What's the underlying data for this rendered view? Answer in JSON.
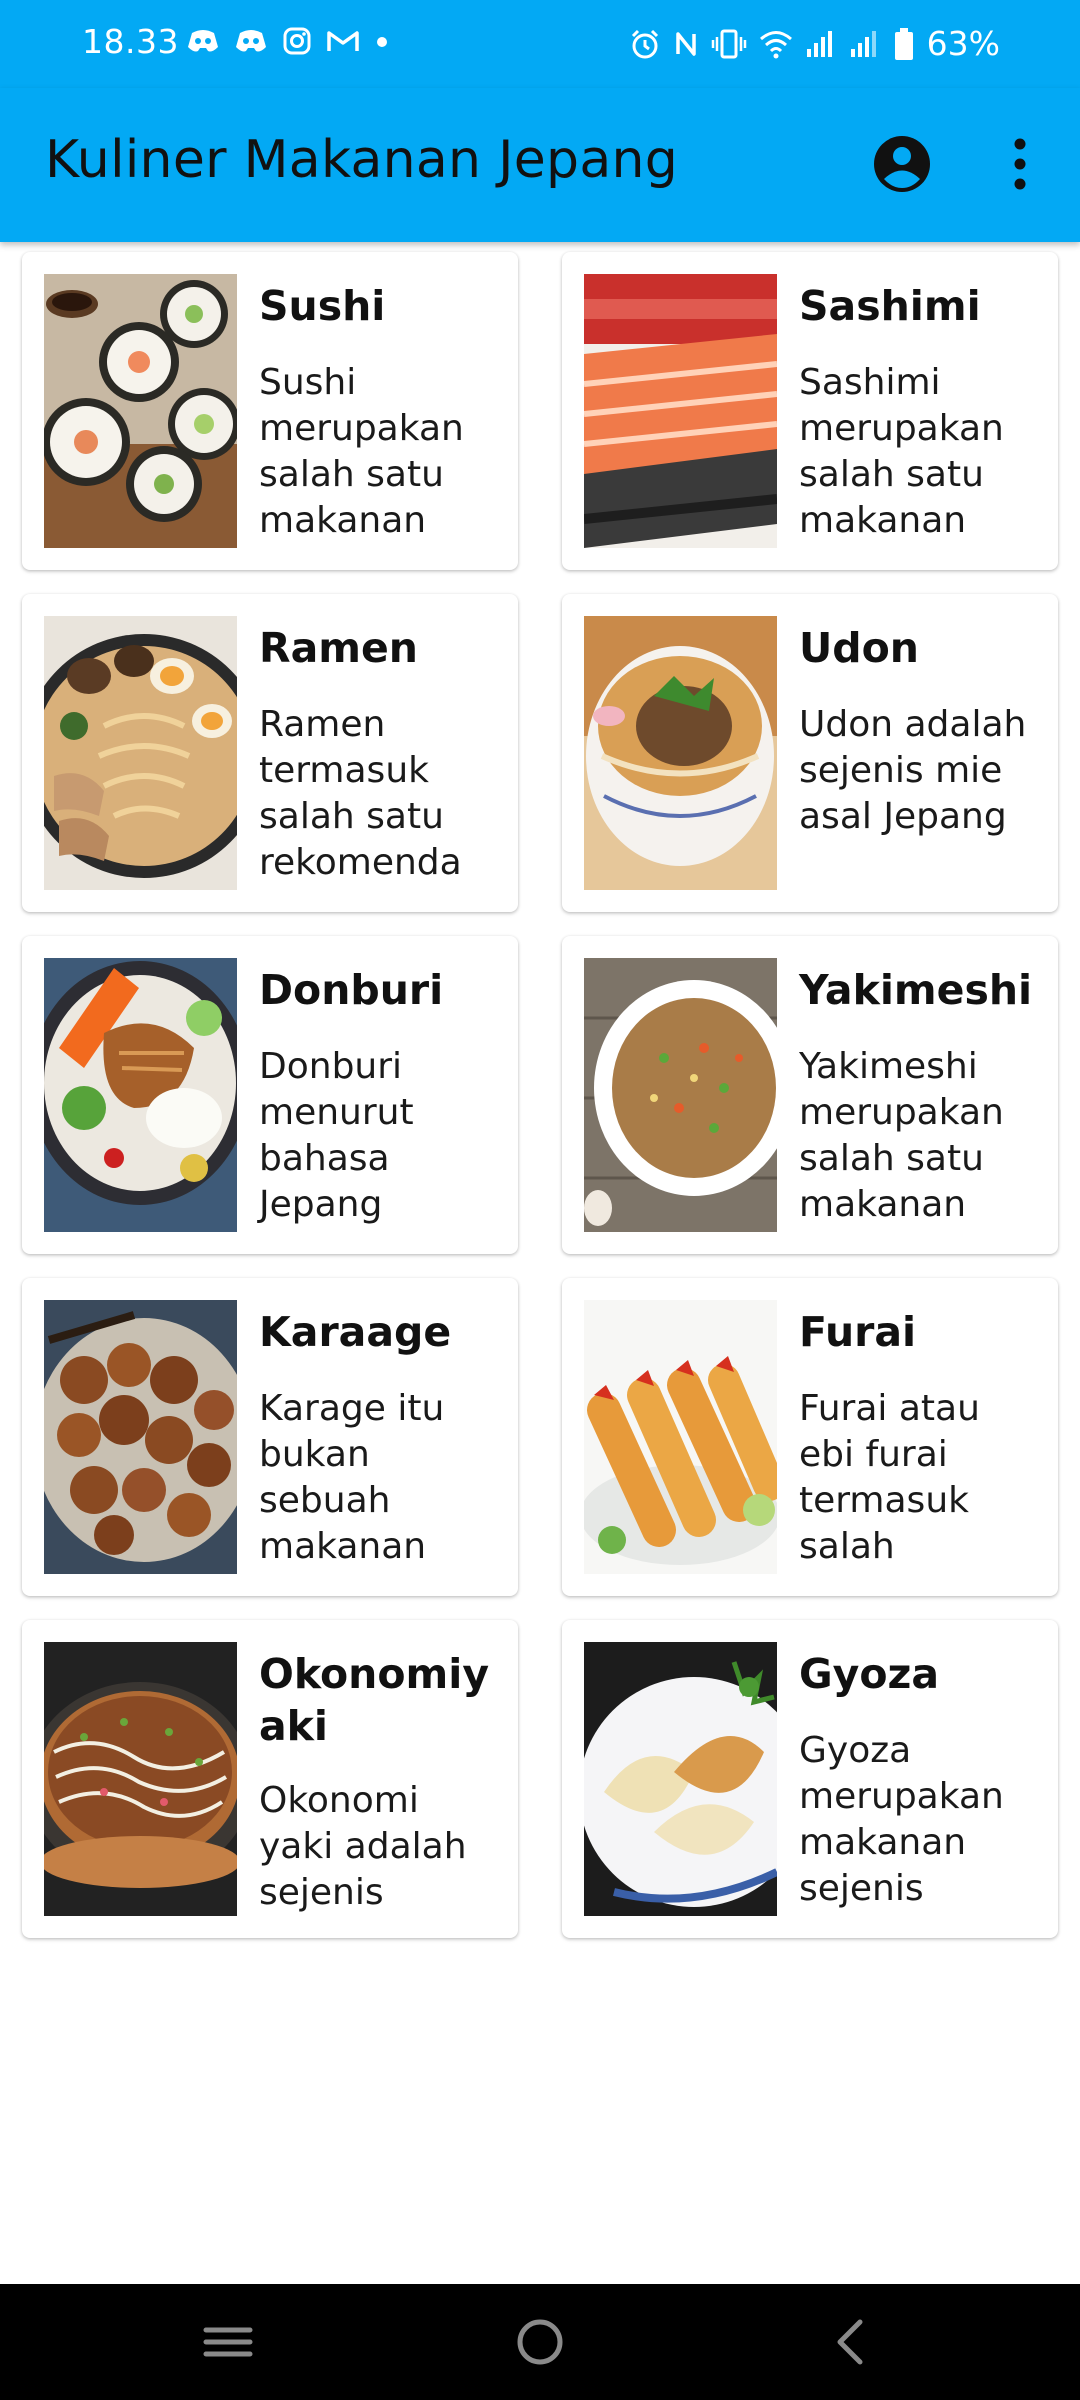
{
  "status_bar": {
    "time": "18.33",
    "battery": "63%",
    "left_icons": [
      "discord-icon",
      "discord-icon",
      "instagram-icon",
      "gmail-icon",
      "dot-icon"
    ],
    "right_icons": [
      "alarm-icon",
      "nfc-icon",
      "vibrate-icon",
      "wifi-icon",
      "signal-icon",
      "signal-icon",
      "battery-icon"
    ]
  },
  "app_bar": {
    "title": "Kuliner Makanan Jepang",
    "color": "#03a9f4",
    "actions": [
      "account-circle-icon",
      "more-vert-icon"
    ]
  },
  "foods": [
    {
      "name": "Sushi",
      "description": "Sushi merupakan salah satu makanan"
    },
    {
      "name": "Sashimi",
      "description": "Sashimi merupakan salah satu makanan"
    },
    {
      "name": "Ramen",
      "description": "Ramen termasuk salah satu rekomenda"
    },
    {
      "name": "Udon",
      "description": "Udon adalah sejenis mie asal Jepang"
    },
    {
      "name": "Donburi",
      "description": "Donburi menurut bahasa Jepang"
    },
    {
      "name": "Yakimeshi",
      "description": "Yakimeshi merupakan salah satu makanan"
    },
    {
      "name": "Karaage",
      "description": "Karage itu bukan sebuah makanan"
    },
    {
      "name": "Furai",
      "description": "Furai atau ebi furai termasuk salah"
    },
    {
      "name": "Okonomiyaki",
      "description": "Okonomi yaki adalah sejenis"
    },
    {
      "name": "Gyoza",
      "description": "Gyoza merupakan makanan sejenis"
    }
  ],
  "nav_bar": {
    "buttons": [
      "recent-apps-icon",
      "home-icon",
      "back-icon"
    ]
  }
}
